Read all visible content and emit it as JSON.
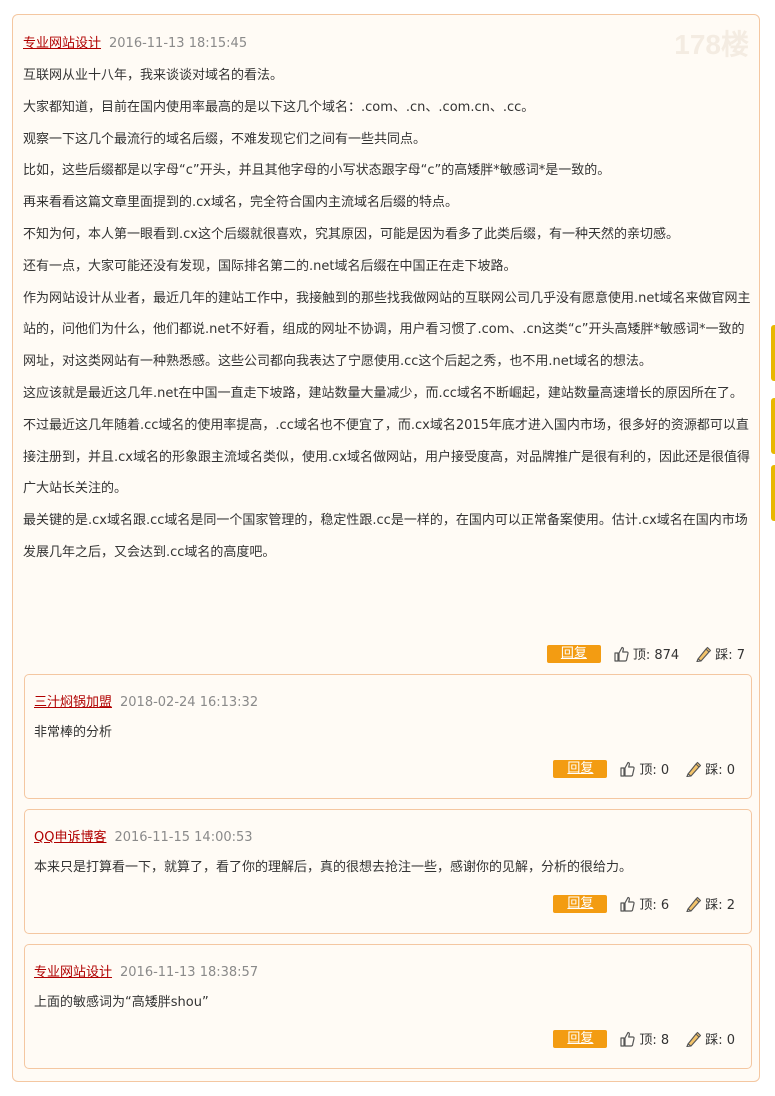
{
  "main": {
    "floor": "178楼",
    "author": "专业网站设计",
    "date": "2016-11-13 18:15:45",
    "paragraphs": [
      "互联网从业十八年，我来谈谈对域名的看法。",
      "大家都知道，目前在国内使用率最高的是以下这几个域名：.com、.cn、.com.cn、.cc。",
      "观察一下这几个最流行的域名后缀，不难发现它们之间有一些共同点。",
      "比如，这些后缀都是以字母“c”开头，并且其他字母的小写状态跟字母“c”的高矮胖*敏感词*是一致的。",
      "再来看看这篇文章里面提到的.cx域名，完全符合国内主流域名后缀的特点。",
      "不知为何，本人第一眼看到.cx这个后缀就很喜欢，究其原因，可能是因为看多了此类后缀，有一种天然的亲切感。",
      "还有一点，大家可能还没有发现，国际排名第二的.net域名后缀在中国正在走下坡路。",
      "作为网站设计从业者，最近几年的建站工作中，我接触到的那些找我做网站的互联网公司几乎没有愿意使用.net域名来做官网主站的，问他们为什么，他们都说.net不好看，组成的网址不协调，用户看习惯了.com、.cn这类“c”开头高矮胖*敏感词*一致的网址，对这类网站有一种熟悉感。这些公司都向我表达了宁愿使用.cc这个后起之秀，也不用.net域名的想法。",
      "这应该就是最近这几年.net在中国一直走下坡路，建站数量大量减少，而.cc域名不断崛起，建站数量高速增长的原因所在了。",
      "不过最近这几年随着.cc域名的使用率提高，.cc域名也不便宜了，而.cx域名2015年底才进入国内市场，很多好的资源都可以直接注册到，并且.cx域名的形象跟主流域名类似，使用.cx域名做网站，用户接受度高，对品牌推广是很有利的，因此还是很值得广大站长关注的。",
      "最关键的是.cx域名跟.cc域名是同一个国家管理的，稳定性跟.cc是一样的，在国内可以正常备案使用。估计.cx域名在国内市场发展几年之后，又会达到.cc域名的高度吧。"
    ],
    "reply_label": "回复",
    "up_label": "顶: 874",
    "down_label": "踩: 7"
  },
  "replies": [
    {
      "author": "三汁焖锅加盟",
      "date": "2018-02-24 16:13:32",
      "text": "非常棒的分析",
      "reply_label": "回复",
      "up_label": "顶: 0",
      "down_label": "踩: 0"
    },
    {
      "author": "QQ申诉博客",
      "date": "2016-11-15 14:00:53",
      "text": "本来只是打算看一下，就算了，看了你的理解后，真的很想去抢注一些，感谢你的见解，分析的很给力。",
      "reply_label": "回复",
      "up_label": "顶: 6",
      "down_label": "踩: 2"
    },
    {
      "author": "专业网站设计",
      "date": "2016-11-13 18:38:57",
      "text": "上面的敏感词为“高矮胖shou”",
      "reply_label": "回复",
      "up_label": "顶: 8",
      "down_label": "踩: 0"
    }
  ],
  "colors": {
    "accent": "#f39c12",
    "author": "#b00000",
    "border": "#f4c7a1",
    "background": "#fffbf5"
  },
  "icons": {
    "up": "thumbs-up-icon",
    "down": "thumbs-down-icon"
  }
}
